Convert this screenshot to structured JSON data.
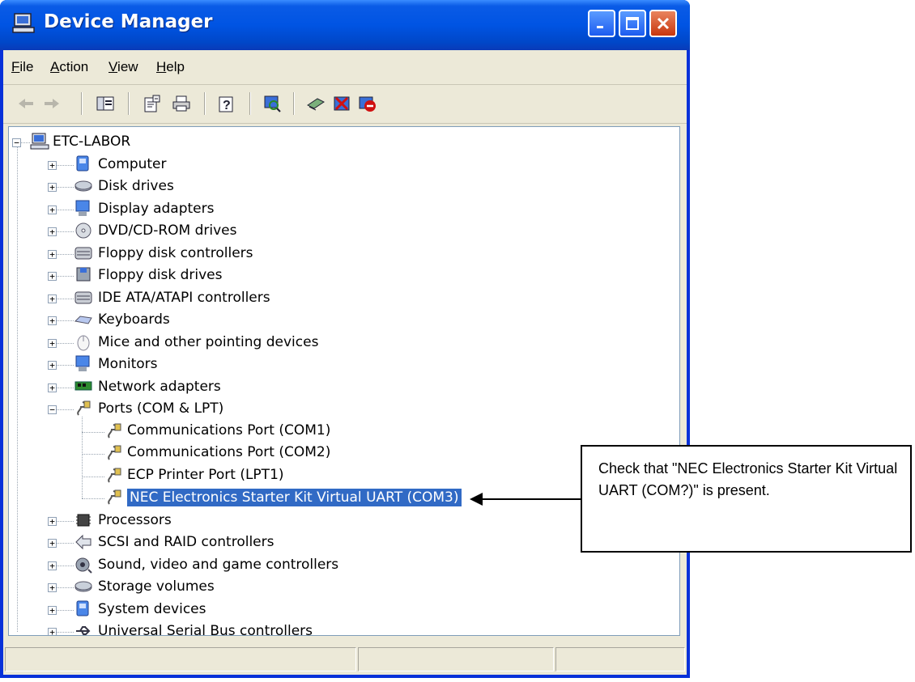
{
  "window": {
    "title": "Device Manager"
  },
  "menu": [
    {
      "label": "File",
      "u": "F",
      "rest": "ile"
    },
    {
      "label": "Action",
      "u": "A",
      "rest": "ction"
    },
    {
      "label": "View",
      "u": "V",
      "rest": "iew"
    },
    {
      "label": "Help",
      "u": "H",
      "rest": "elp"
    }
  ],
  "toolbar_icons": [
    "back-arrow-icon",
    "forward-arrow-icon",
    "show-hide-console-tree-icon",
    "properties-icon",
    "print-icon",
    "help-icon",
    "scan-hardware-icon",
    "update-driver-icon",
    "uninstall-icon",
    "disable-icon"
  ],
  "tree": {
    "root": "ETC-LABOR",
    "categories": [
      {
        "label": "Computer",
        "icon": "computer-icon"
      },
      {
        "label": "Disk drives",
        "icon": "disk-drive-icon"
      },
      {
        "label": "Display adapters",
        "icon": "display-adapter-icon"
      },
      {
        "label": "DVD/CD-ROM drives",
        "icon": "cdrom-icon"
      },
      {
        "label": "Floppy disk controllers",
        "icon": "floppy-controller-icon"
      },
      {
        "label": "Floppy disk drives",
        "icon": "floppy-drive-icon"
      },
      {
        "label": "IDE ATA/ATAPI controllers",
        "icon": "ide-controller-icon"
      },
      {
        "label": "Keyboards",
        "icon": "keyboard-icon"
      },
      {
        "label": "Mice and other pointing devices",
        "icon": "mouse-icon"
      },
      {
        "label": "Monitors",
        "icon": "monitor-icon"
      },
      {
        "label": "Network adapters",
        "icon": "network-adapter-icon"
      },
      {
        "label": "Ports (COM & LPT)",
        "icon": "port-icon"
      },
      {
        "label": "Processors",
        "icon": "processor-icon"
      },
      {
        "label": "SCSI and RAID controllers",
        "icon": "scsi-icon"
      },
      {
        "label": "Sound, video and game controllers",
        "icon": "sound-icon"
      },
      {
        "label": "Storage volumes",
        "icon": "storage-volume-icon"
      },
      {
        "label": "System devices",
        "icon": "system-device-icon"
      },
      {
        "label": "Universal Serial Bus controllers",
        "icon": "usb-icon"
      }
    ],
    "ports_children": [
      "Communications Port (COM1)",
      "Communications Port (COM2)",
      "ECP Printer Port (LPT1)",
      "NEC Electronics Starter Kit Virtual UART (COM3)"
    ]
  },
  "callout": {
    "text": "Check that \"NEC Electronics Starter Kit Virtual UART (COM?)\" is present."
  }
}
